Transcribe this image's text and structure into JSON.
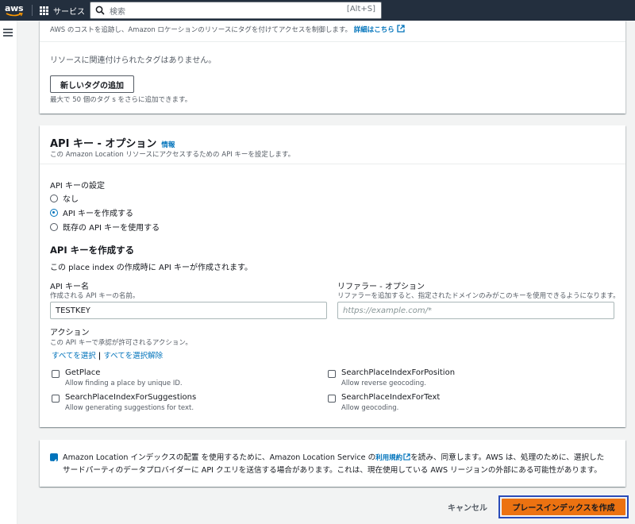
{
  "nav": {
    "logo": "aws",
    "services": "サービス",
    "search_placeholder": "検索",
    "search_shortcut": "[Alt+S]"
  },
  "tags": {
    "description": "AWS のコストを追跡し、Amazon ロケーションのリソースにタグを付けてアクセスを制御します。",
    "learn_more": "詳細はこちら",
    "empty_text": "リソースに関連付けられたタグはありません。",
    "add_tag_button": "新しいタグの追加",
    "limit_text": "最大で 50 個のタグ s をさらに追加できます。"
  },
  "api_key": {
    "title": "API キー - オプション",
    "info_link": "情報",
    "description": "この Amazon Location リソースにアクセスするための API キーを設定します。",
    "setting_label": "API キーの設定",
    "options": [
      {
        "label": "なし",
        "selected": false
      },
      {
        "label": "API キーを作成する",
        "selected": true
      },
      {
        "label": "既存の API キーを使用する",
        "selected": false
      }
    ],
    "create_title": "API キーを作成する",
    "create_description": "この place index の作成時に API キーが作成されます。",
    "name_label": "API キー名",
    "name_hint": "作成される API キーの名前。",
    "name_value": "TESTKEY",
    "referrer_label": "リファラー - オプション",
    "referrer_hint": "リファラーを追加すると、指定されたドメインのみがこのキーを使用できるようになります。",
    "referrer_placeholder": "https://example.com/*",
    "actions_label": "アクション",
    "actions_hint": "この API キーで承認が許可されるアクション。",
    "select_all": "すべてを選択",
    "separator": "|",
    "deselect_all": "すべてを選択解除",
    "actions": [
      {
        "name": "GetPlace",
        "desc": "Allow finding a place by unique ID.",
        "checked": false
      },
      {
        "name": "SearchPlaceIndexForPosition",
        "desc": "Allow reverse geocoding.",
        "checked": false
      },
      {
        "name": "SearchPlaceIndexForSuggestions",
        "desc": "Allow generating suggestions for text.",
        "checked": false
      },
      {
        "name": "SearchPlaceIndexForText",
        "desc": "Allow geocoding.",
        "checked": false
      }
    ]
  },
  "agreement": {
    "checked": true,
    "text_before": "Amazon Location インデックスの配置 を使用するために、Amazon Location Service の",
    "terms_link": "利用規約",
    "text_after": "を読み、同意します。AWS は、処理のために、選択したサードパーティのデータプロバイダーに API クエリを送信する場合があります。これは、現在使用している AWS リージョンの外部にある可能性があります。"
  },
  "footer": {
    "cancel": "キャンセル",
    "create": "プレースインデックスを作成"
  },
  "colors": {
    "nav_bg": "#232f3e",
    "link": "#0073bb",
    "primary": "#ec7211",
    "focus_ring": "#2a4bb8"
  }
}
